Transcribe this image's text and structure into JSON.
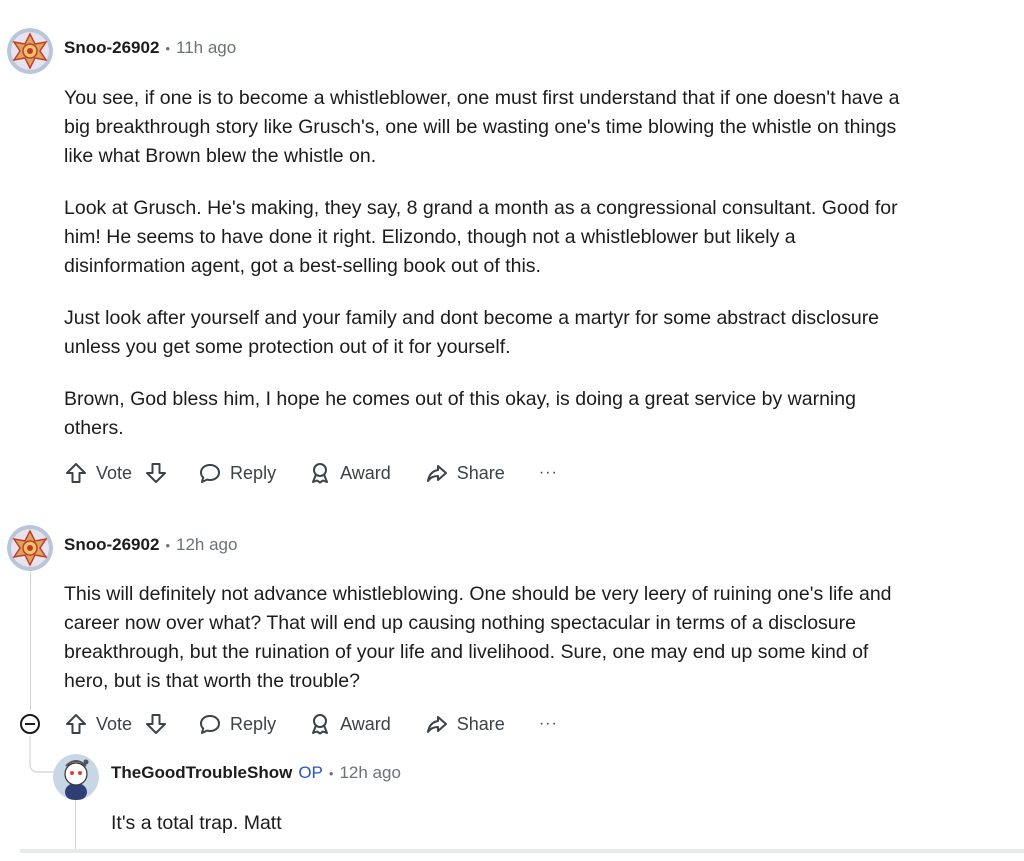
{
  "comments": [
    {
      "author": "Snoo-26902",
      "time": "11h ago",
      "paragraphs": [
        "You see, if one is to become a whistleblower, one must first understand that if one doesn't have a big breakthrough story like Grusch's, one will be wasting one's time blowing the whistle on things like what Brown blew the whistle on.",
        "Look at Grusch. He's making, they say, 8 grand a month as a congressional consultant. Good for him! He seems to have done it right. Elizondo, though not a whistleblower but likely a disinformation agent, got a best-selling book out of this.",
        "Just look after yourself and your family and dont become a martyr for some abstract disclosure unless you get some protection out of it for yourself.",
        "Brown, God bless him, I hope he comes out of this okay, is doing a great service by warning others."
      ]
    },
    {
      "author": "Snoo-26902",
      "time": "12h ago",
      "paragraphs": [
        "This will definitely not advance whistleblowing. One should be very leery of ruining one's life and career now over what? That will end up causing nothing spectacular in terms of a disclosure breakthrough, but the ruination of your life and livelihood. Sure, one may end up some kind of hero, but is that worth the trouble?"
      ]
    },
    {
      "author": "TheGoodTroubleShow",
      "op_badge": "OP",
      "time": "12h ago",
      "paragraphs": [
        "It's a total trap. Matt"
      ]
    }
  ],
  "actions": {
    "vote": "Vote",
    "reply": "Reply",
    "award": "Award",
    "share": "Share",
    "more": "···"
  },
  "icons": [
    "upvote-icon",
    "downvote-icon",
    "reply-icon",
    "award-icon",
    "share-icon",
    "more-icon",
    "collapse-icon"
  ],
  "colors": {
    "op": "#2a54c9",
    "meta": "#6b7278",
    "text": "#1c1c1c"
  }
}
